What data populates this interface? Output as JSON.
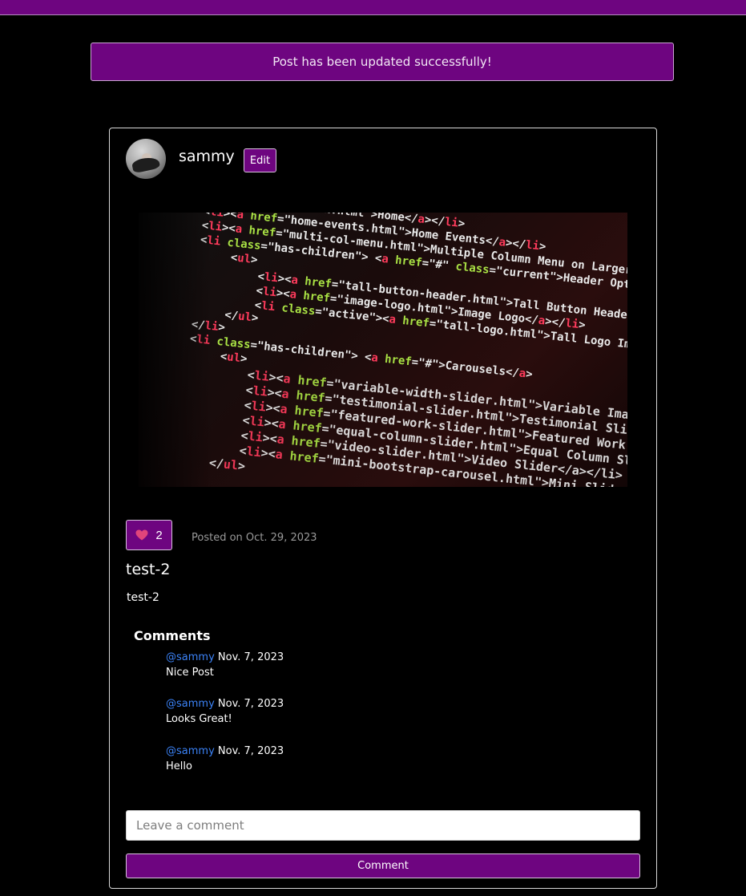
{
  "alert": {
    "message": "Post has been updated successfully!"
  },
  "post": {
    "author": "sammy",
    "edit_label": "Edit",
    "like_count": "2",
    "posted_on": "Posted on Oct. 29, 2023",
    "title": "test-2",
    "body": "test-2"
  },
  "comments": {
    "heading": "Comments",
    "items": [
      {
        "author": "@sammy",
        "date": "Nov. 7, 2023",
        "text": "Nice Post"
      },
      {
        "author": "@sammy",
        "date": "Nov. 7, 2023",
        "text": "Looks Great!"
      },
      {
        "author": "@sammy",
        "date": "Nov. 7, 2023",
        "text": "Hello"
      }
    ]
  },
  "comment_form": {
    "placeholder": "Leave a comment",
    "submit_label": "Comment"
  },
  "theme": {
    "accent": "#6e0580",
    "link": "#3b82f6",
    "background": "#000000"
  },
  "icons": {
    "like": "heart-icon"
  }
}
